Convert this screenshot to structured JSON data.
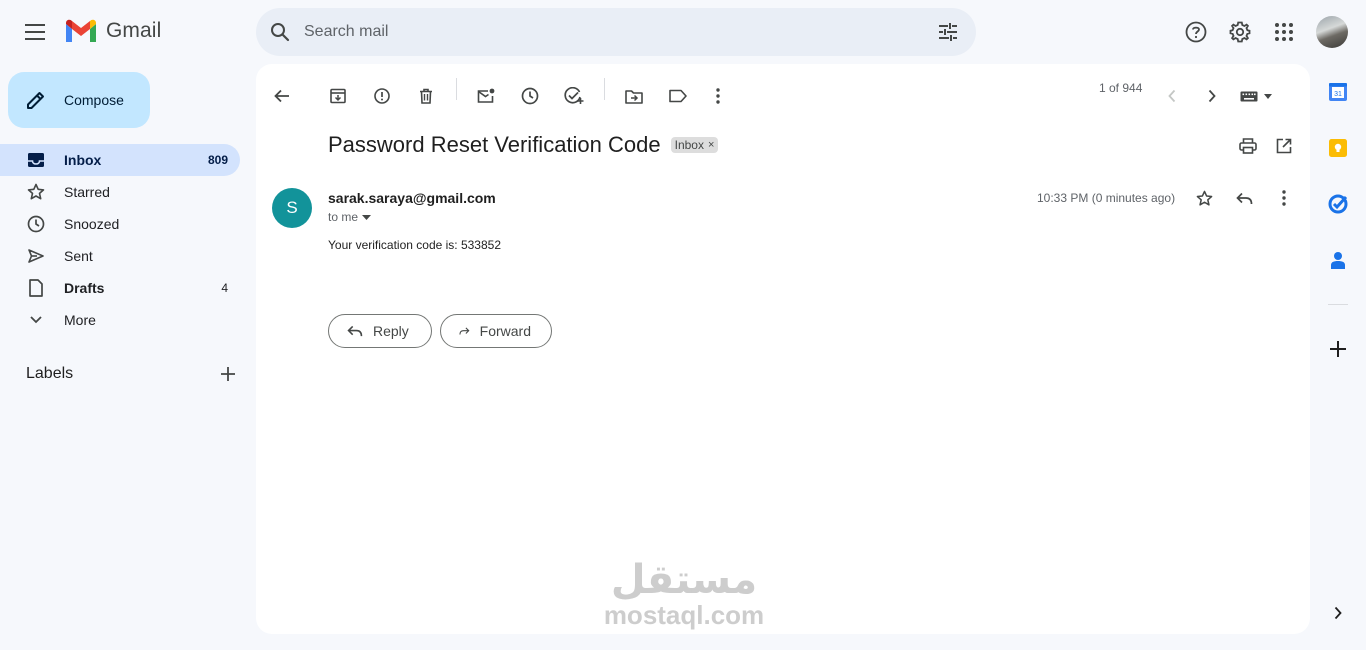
{
  "app": {
    "name": "Gmail"
  },
  "search": {
    "placeholder": "Search mail"
  },
  "sidebar": {
    "compose_label": "Compose",
    "items": [
      {
        "label": "Inbox",
        "count": "809"
      },
      {
        "label": "Starred",
        "count": ""
      },
      {
        "label": "Snoozed",
        "count": ""
      },
      {
        "label": "Sent",
        "count": ""
      },
      {
        "label": "Drafts",
        "count": "4"
      },
      {
        "label": "More",
        "count": ""
      }
    ],
    "labels_heading": "Labels"
  },
  "toolbar": {
    "pager": "1 of 944",
    "icons": [
      "back-icon",
      "archive-icon",
      "report-spam-icon",
      "delete-icon",
      "mark-unread-icon",
      "snooze-icon",
      "add-task-icon",
      "move-to-icon",
      "label-icon",
      "more-vert-icon",
      "prev-icon",
      "next-icon",
      "keyboard-icon"
    ]
  },
  "message": {
    "subject": "Password Reset Verification Code",
    "label_chip": "Inbox",
    "sender_initial": "S",
    "sender_email": "sarak.saraya@gmail.com",
    "recipient": "to me",
    "time": "10:33 PM (0 minutes ago)",
    "body": "Your verification code is: 533852",
    "reply_label": "Reply",
    "forward_label": "Forward"
  },
  "watermark": {
    "arabic": "مستقل",
    "latin": "mostaql.com"
  },
  "colors": {
    "compose_bg": "#c2e7ff",
    "active_nav": "#d3e3fd",
    "avatar_teal": "#12939a",
    "background": "#f6f8fc"
  }
}
